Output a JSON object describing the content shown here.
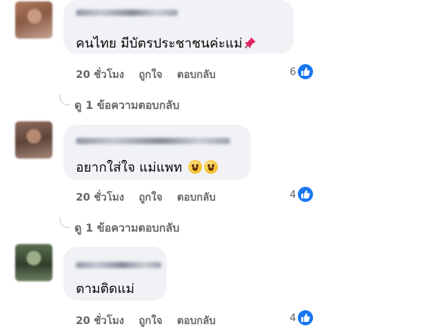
{
  "comments": [
    {
      "author_hidden": "",
      "text": "คนไทย มีบัตรประชาชนค่ะแม่",
      "text_icon": "pushpin-icon",
      "time": "20 ชั่วโมง",
      "like_label": "ถูกใจ",
      "reply_label": "ตอบกลับ",
      "reaction_count": "6",
      "view_replies": "ดู 1 ข้อความตอบกลับ"
    },
    {
      "author_hidden": "",
      "text": "อยากใส่ใจ แม่แพท",
      "text_icon": "smiling-face-emoji-icon",
      "time": "20 ชั่วโมง",
      "like_label": "ถูกใจ",
      "reply_label": "ตอบกลับ",
      "reaction_count": "4",
      "view_replies": "ดู 1 ข้อความตอบกลับ"
    },
    {
      "author_hidden": "",
      "text": "ตามติดแม่",
      "time": "20 ชั่วโมง",
      "like_label": "ถูกใจ",
      "reply_label": "ตอบกลับ",
      "reaction_count": "4"
    }
  ],
  "colors": {
    "bubble": "#f0f2f5",
    "meta_text": "#65676b",
    "like_blue": "#1877f2"
  }
}
